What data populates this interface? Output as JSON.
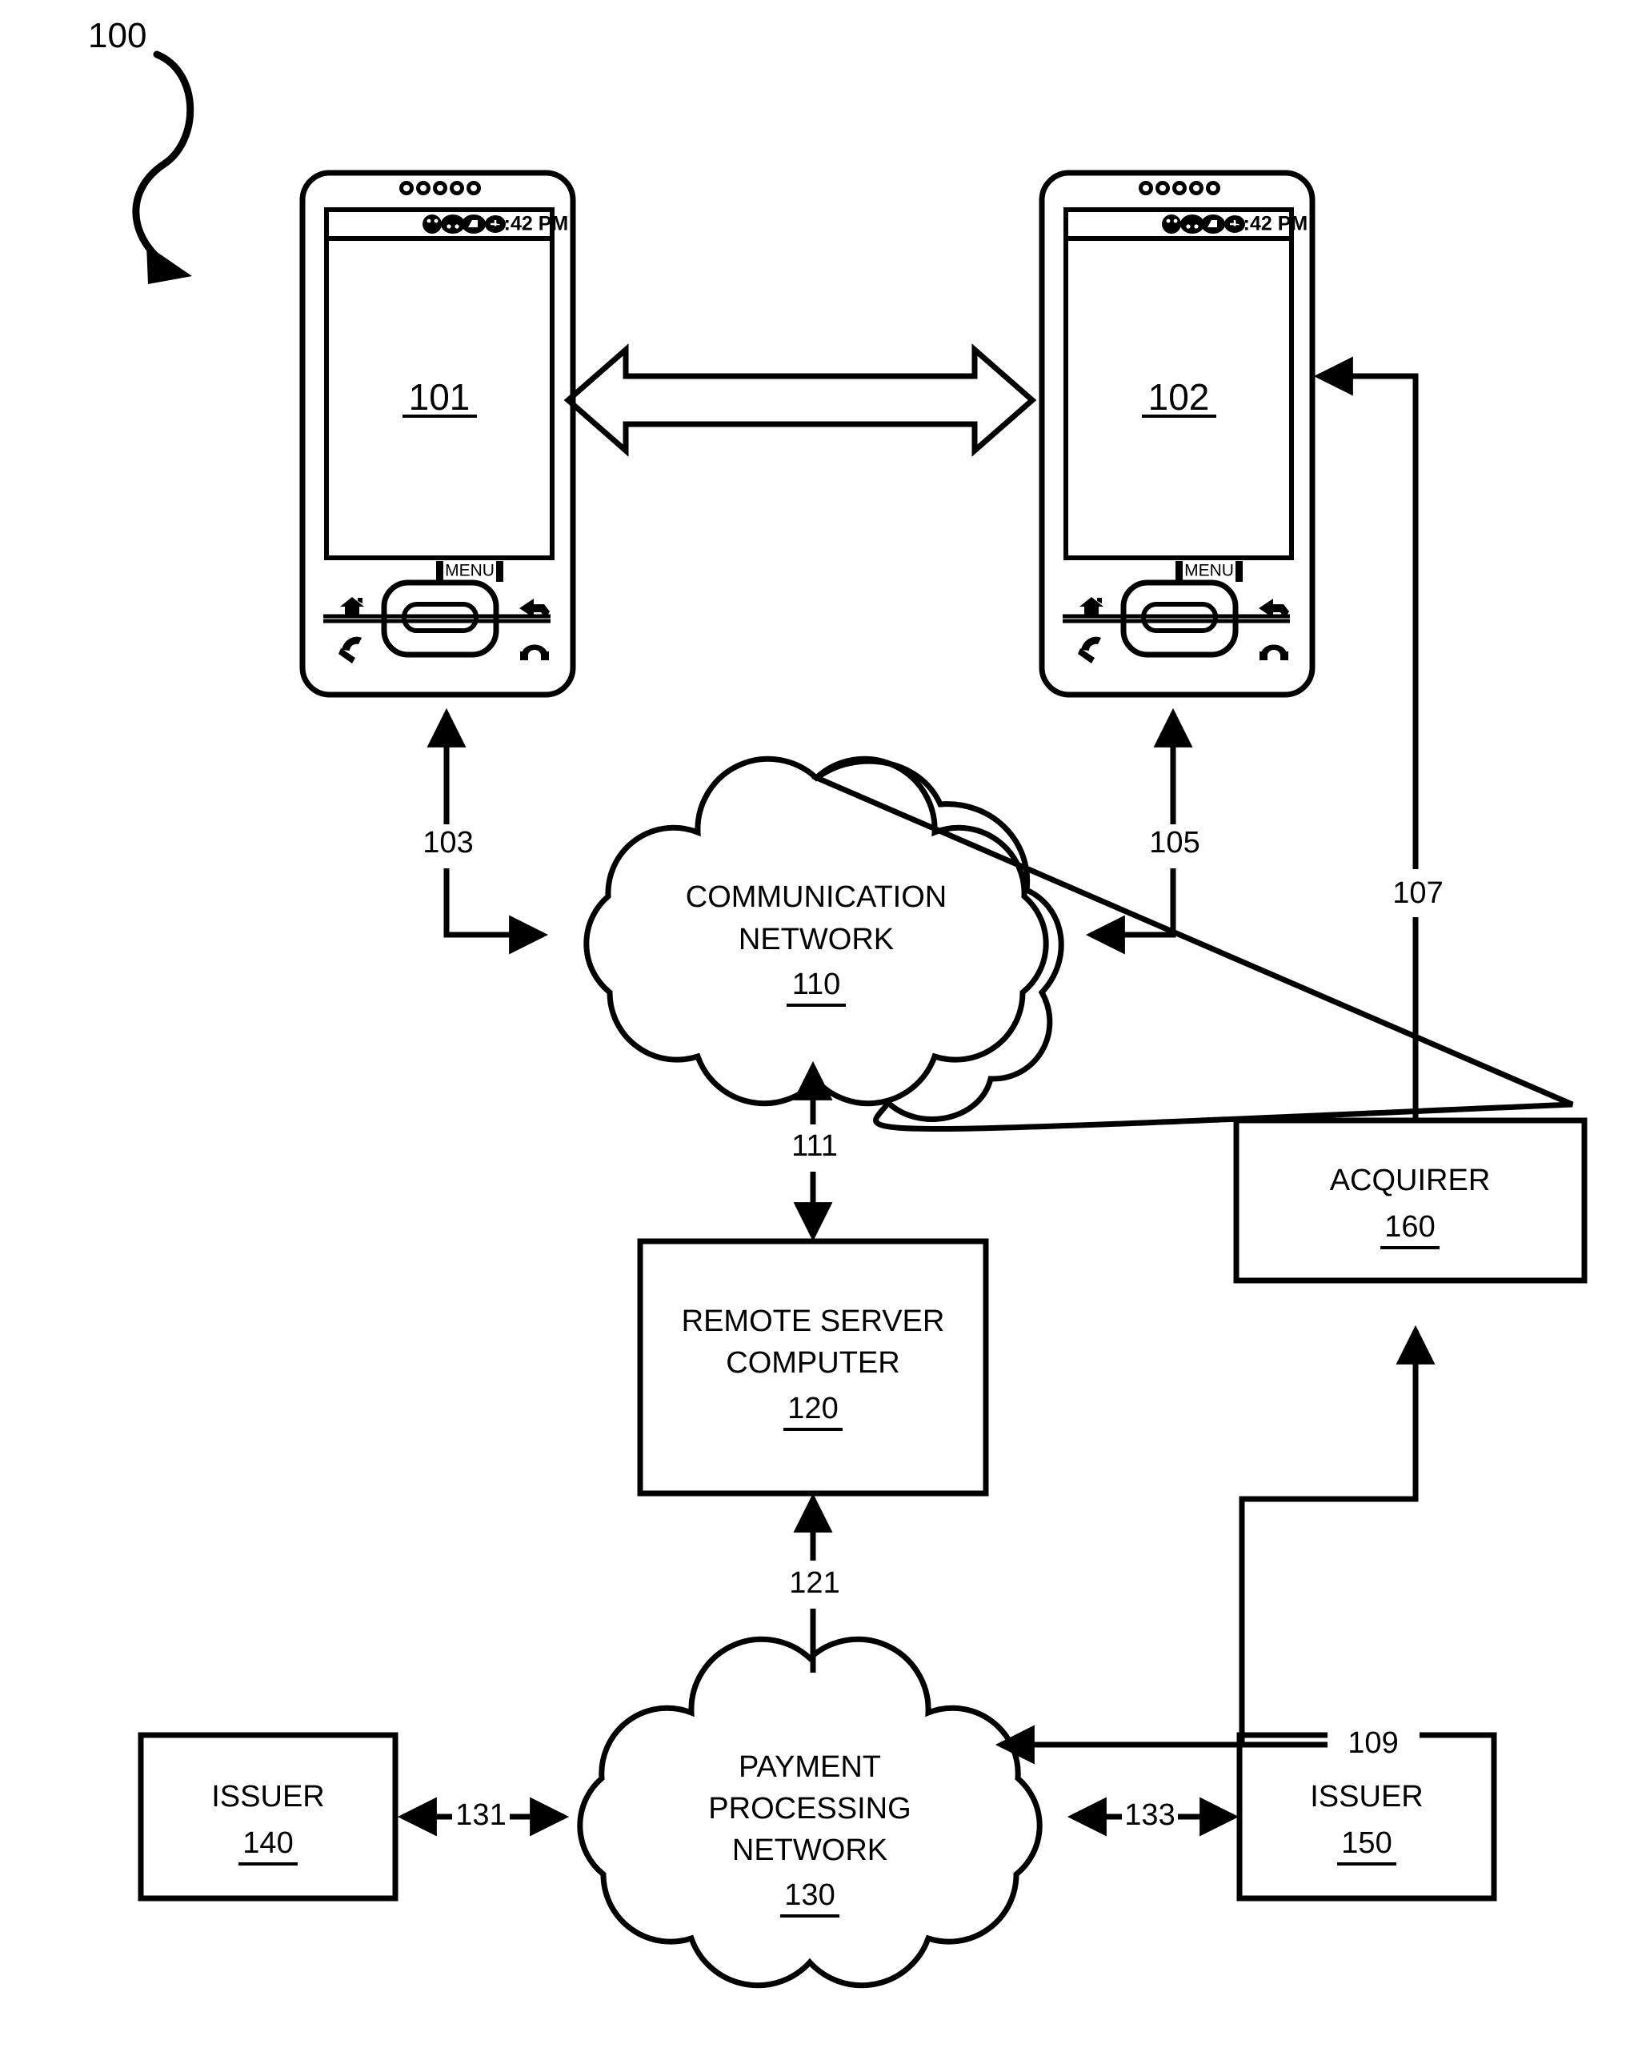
{
  "figure": {
    "system_label": "100"
  },
  "devices": [
    {
      "name": "mobile-device-left",
      "screen_ref": "101",
      "status_time": "3:42 PM",
      "menu_label": "MENU",
      "icons": [
        "smiley-icon",
        "signal-icon",
        "message-icon",
        "network-icon"
      ],
      "keys": [
        "home-icon",
        "back-icon",
        "call-icon",
        "end-call-icon"
      ]
    },
    {
      "name": "mobile-device-right",
      "screen_ref": "102",
      "status_time": "3:42 PM",
      "menu_label": "MENU",
      "icons": [
        "smiley-icon",
        "signal-icon",
        "message-icon",
        "network-icon"
      ],
      "keys": [
        "home-icon",
        "back-icon",
        "call-icon",
        "end-call-icon"
      ]
    }
  ],
  "nodes": {
    "communication_network": {
      "line1": "COMMUNICATION",
      "line2": "NETWORK",
      "ref": "110"
    },
    "remote_server": {
      "line1": "REMOTE SERVER",
      "line2": "COMPUTER",
      "ref": "120"
    },
    "payment_network": {
      "line1": "PAYMENT",
      "line2": "PROCESSING",
      "line3": "NETWORK",
      "ref": "130"
    },
    "issuer_left": {
      "label": "ISSUER",
      "ref": "140"
    },
    "issuer_right": {
      "label": "ISSUER",
      "ref": "150"
    },
    "acquirer": {
      "label": "ACQUIRER",
      "ref": "160"
    }
  },
  "connectors": {
    "device_to_device": "",
    "device1_to_network": "103",
    "device2_to_network": "105",
    "acquirer_to_device2": "107",
    "acquirer_to_payment_network": "109",
    "network_to_server": "111",
    "server_to_payment_network": "121",
    "issuer140_to_payment_network": "131",
    "payment_network_to_issuer150": "133"
  },
  "colors": {
    "stroke": "#000000",
    "background": "#ffffff"
  }
}
